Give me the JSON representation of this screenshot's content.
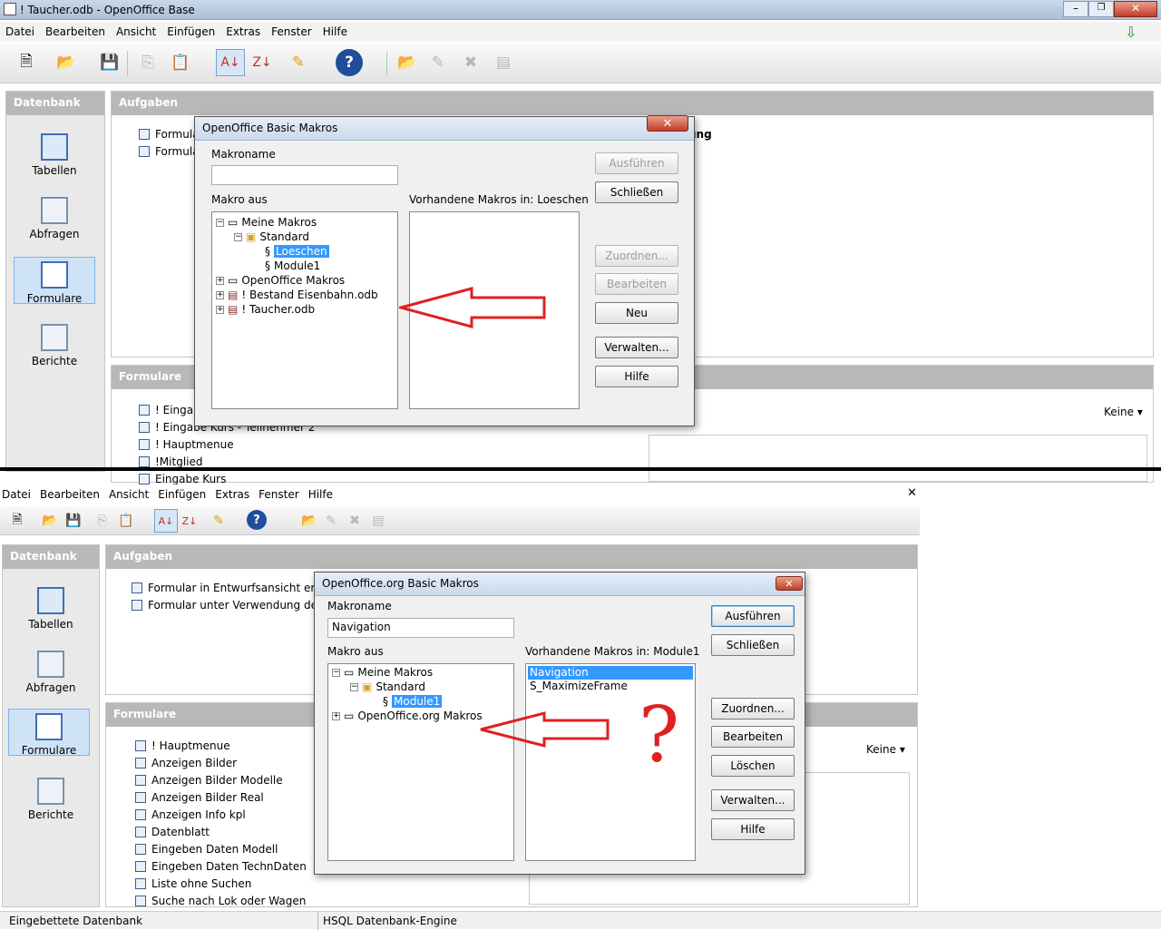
{
  "top_window": {
    "title": "! Taucher.odb - OpenOffice Base",
    "menu": [
      "Datei",
      "Bearbeiten",
      "Ansicht",
      "Einfügen",
      "Extras",
      "Fenster",
      "Hilfe"
    ],
    "datenbank_title": "Datenbank",
    "left_items": [
      "Tabellen",
      "Abfragen",
      "Formulare",
      "Berichte"
    ],
    "aufgaben_title": "Aufgaben",
    "aufgaben_items": [
      "Formula",
      "Formula"
    ],
    "aufgaben_desc_fragment": "ung",
    "formulare_title": "Formulare",
    "forms": [
      "! Eingab",
      "! Eingabe Kurs - Teilnehmer 2",
      "! Hauptmenue",
      "!Mitglied",
      "Eingabe Kurs"
    ],
    "preview_option": "Keine"
  },
  "top_dialog": {
    "title": "OpenOffice Basic Makros",
    "makroname_label": "Makroname",
    "makroname_value": "",
    "makro_aus_label": "Makro aus",
    "vorhandene_label": "Vorhandene Makros in: Loeschen",
    "tree": [
      "Meine Makros",
      "Standard",
      "Loeschen",
      "Module1",
      "OpenOffice Makros",
      "! Bestand Eisenbahn.odb",
      "! Taucher.odb"
    ],
    "macros": [],
    "buttons": {
      "run": "Ausführen",
      "close": "Schließen",
      "assign": "Zuordnen...",
      "edit": "Bearbeiten",
      "new": "Neu",
      "manage": "Verwalten...",
      "help": "Hilfe"
    }
  },
  "bottom_window": {
    "menu": [
      "Datei",
      "Bearbeiten",
      "Ansicht",
      "Einfügen",
      "Extras",
      "Fenster",
      "Hilfe"
    ],
    "datenbank_title": "Datenbank",
    "left_items": [
      "Tabellen",
      "Abfragen",
      "Formulare",
      "Berichte"
    ],
    "aufgaben_title": "Aufgaben",
    "aufgaben_items": [
      "Formular in Entwurfsansicht erstell",
      "Formular unter Verwendung des A"
    ],
    "formulare_title": "Formulare",
    "forms": [
      "! Hauptmenue",
      "Anzeigen Bilder",
      "Anzeigen Bilder Modelle",
      "Anzeigen Bilder Real",
      "Anzeigen Info kpl",
      "Datenblatt",
      "Eingeben Daten Modell",
      "Eingeben Daten TechnDaten",
      "Liste ohne Suchen",
      "Suche nach Lok oder Wagen"
    ],
    "preview_option": "Keine",
    "status_left": "Eingebettete Datenbank",
    "status_right": "HSQL Datenbank-Engine"
  },
  "bottom_dialog": {
    "title": "OpenOffice.org Basic Makros",
    "makroname_label": "Makroname",
    "makroname_value": "Navigation",
    "makro_aus_label": "Makro aus",
    "vorhandene_label": "Vorhandene Makros in: Module1",
    "tree": [
      "Meine Makros",
      "Standard",
      "Module1",
      "OpenOffice.org Makros"
    ],
    "macros": [
      "Navigation",
      "S_MaximizeFrame"
    ],
    "buttons": {
      "run": "Ausführen",
      "close": "Schließen",
      "assign": "Zuordnen...",
      "edit": "Bearbeiten",
      "delete": "Löschen",
      "manage": "Verwalten...",
      "help": "Hilfe"
    }
  },
  "annotation": {
    "question_mark": "?",
    "arrow_color": "#e02020"
  }
}
